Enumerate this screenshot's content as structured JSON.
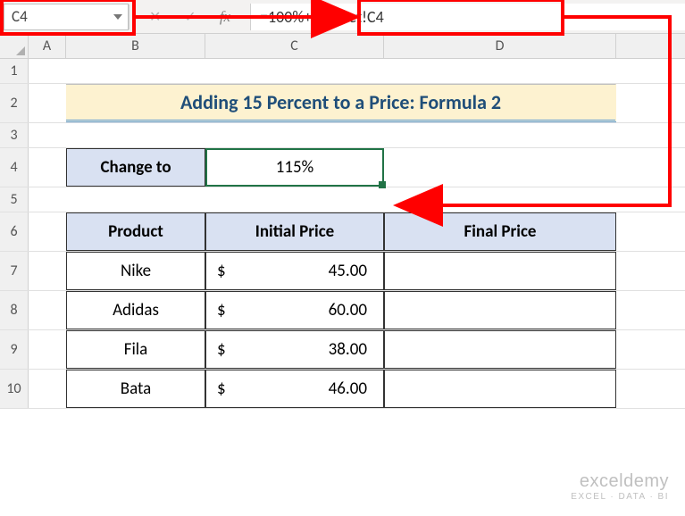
{
  "formula_bar": {
    "name_box": "C4",
    "formula": "=100%+Dataset!C4"
  },
  "columns": {
    "A": "A",
    "B": "B",
    "C": "C",
    "D": "D"
  },
  "rows": [
    "1",
    "2",
    "3",
    "4",
    "5",
    "6",
    "7",
    "8",
    "9",
    "10"
  ],
  "title": "Adding 15 Percent to a Price: Formula 2",
  "change_to": {
    "label": "Change to",
    "value": "115%"
  },
  "table": {
    "headers": {
      "product": "Product",
      "initial": "Initial Price",
      "final": "Final Price"
    },
    "rows": [
      {
        "product": "Nike",
        "currency": "$",
        "initial": "45.00",
        "final": ""
      },
      {
        "product": "Adidas",
        "currency": "$",
        "initial": "60.00",
        "final": ""
      },
      {
        "product": "Fila",
        "currency": "$",
        "initial": "38.00",
        "final": ""
      },
      {
        "product": "Bata",
        "currency": "$",
        "initial": "46.00",
        "final": ""
      }
    ]
  },
  "watermark": {
    "line1": "exceldemy",
    "line2": "EXCEL · DATA · BI"
  },
  "chart_data": {
    "type": "table",
    "title": "Adding 15 Percent to a Price: Formula 2",
    "change_percent": 115,
    "columns": [
      "Product",
      "Initial Price",
      "Final Price"
    ],
    "rows": [
      [
        "Nike",
        45.0,
        null
      ],
      [
        "Adidas",
        60.0,
        null
      ],
      [
        "Fila",
        38.0,
        null
      ],
      [
        "Bata",
        46.0,
        null
      ]
    ]
  }
}
